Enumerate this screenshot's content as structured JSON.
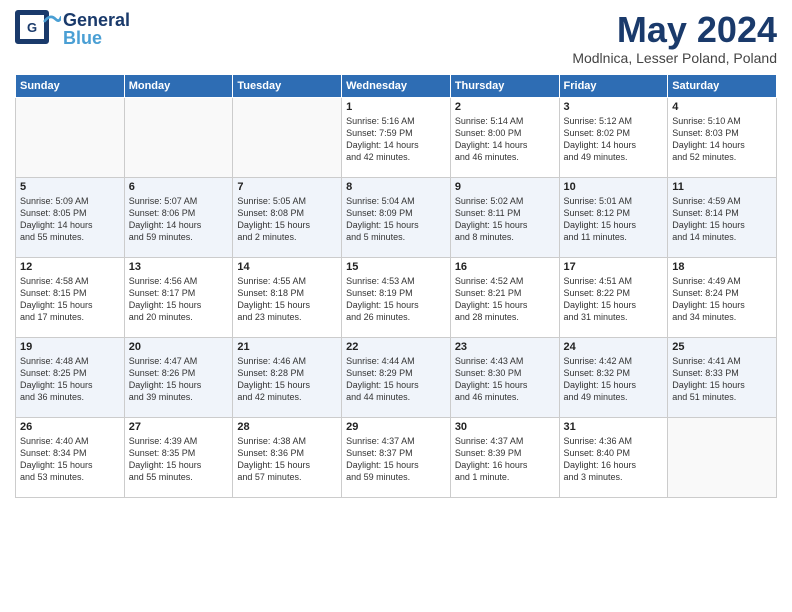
{
  "header": {
    "logo_general": "General",
    "logo_blue": "Blue",
    "title": "May 2024",
    "location": "Modlnica, Lesser Poland, Poland"
  },
  "columns": [
    "Sunday",
    "Monday",
    "Tuesday",
    "Wednesday",
    "Thursday",
    "Friday",
    "Saturday"
  ],
  "weeks": [
    [
      {
        "day": "",
        "info": ""
      },
      {
        "day": "",
        "info": ""
      },
      {
        "day": "",
        "info": ""
      },
      {
        "day": "1",
        "info": "Sunrise: 5:16 AM\nSunset: 7:59 PM\nDaylight: 14 hours\nand 42 minutes."
      },
      {
        "day": "2",
        "info": "Sunrise: 5:14 AM\nSunset: 8:00 PM\nDaylight: 14 hours\nand 46 minutes."
      },
      {
        "day": "3",
        "info": "Sunrise: 5:12 AM\nSunset: 8:02 PM\nDaylight: 14 hours\nand 49 minutes."
      },
      {
        "day": "4",
        "info": "Sunrise: 5:10 AM\nSunset: 8:03 PM\nDaylight: 14 hours\nand 52 minutes."
      }
    ],
    [
      {
        "day": "5",
        "info": "Sunrise: 5:09 AM\nSunset: 8:05 PM\nDaylight: 14 hours\nand 55 minutes."
      },
      {
        "day": "6",
        "info": "Sunrise: 5:07 AM\nSunset: 8:06 PM\nDaylight: 14 hours\nand 59 minutes."
      },
      {
        "day": "7",
        "info": "Sunrise: 5:05 AM\nSunset: 8:08 PM\nDaylight: 15 hours\nand 2 minutes."
      },
      {
        "day": "8",
        "info": "Sunrise: 5:04 AM\nSunset: 8:09 PM\nDaylight: 15 hours\nand 5 minutes."
      },
      {
        "day": "9",
        "info": "Sunrise: 5:02 AM\nSunset: 8:11 PM\nDaylight: 15 hours\nand 8 minutes."
      },
      {
        "day": "10",
        "info": "Sunrise: 5:01 AM\nSunset: 8:12 PM\nDaylight: 15 hours\nand 11 minutes."
      },
      {
        "day": "11",
        "info": "Sunrise: 4:59 AM\nSunset: 8:14 PM\nDaylight: 15 hours\nand 14 minutes."
      }
    ],
    [
      {
        "day": "12",
        "info": "Sunrise: 4:58 AM\nSunset: 8:15 PM\nDaylight: 15 hours\nand 17 minutes."
      },
      {
        "day": "13",
        "info": "Sunrise: 4:56 AM\nSunset: 8:17 PM\nDaylight: 15 hours\nand 20 minutes."
      },
      {
        "day": "14",
        "info": "Sunrise: 4:55 AM\nSunset: 8:18 PM\nDaylight: 15 hours\nand 23 minutes."
      },
      {
        "day": "15",
        "info": "Sunrise: 4:53 AM\nSunset: 8:19 PM\nDaylight: 15 hours\nand 26 minutes."
      },
      {
        "day": "16",
        "info": "Sunrise: 4:52 AM\nSunset: 8:21 PM\nDaylight: 15 hours\nand 28 minutes."
      },
      {
        "day": "17",
        "info": "Sunrise: 4:51 AM\nSunset: 8:22 PM\nDaylight: 15 hours\nand 31 minutes."
      },
      {
        "day": "18",
        "info": "Sunrise: 4:49 AM\nSunset: 8:24 PM\nDaylight: 15 hours\nand 34 minutes."
      }
    ],
    [
      {
        "day": "19",
        "info": "Sunrise: 4:48 AM\nSunset: 8:25 PM\nDaylight: 15 hours\nand 36 minutes."
      },
      {
        "day": "20",
        "info": "Sunrise: 4:47 AM\nSunset: 8:26 PM\nDaylight: 15 hours\nand 39 minutes."
      },
      {
        "day": "21",
        "info": "Sunrise: 4:46 AM\nSunset: 8:28 PM\nDaylight: 15 hours\nand 42 minutes."
      },
      {
        "day": "22",
        "info": "Sunrise: 4:44 AM\nSunset: 8:29 PM\nDaylight: 15 hours\nand 44 minutes."
      },
      {
        "day": "23",
        "info": "Sunrise: 4:43 AM\nSunset: 8:30 PM\nDaylight: 15 hours\nand 46 minutes."
      },
      {
        "day": "24",
        "info": "Sunrise: 4:42 AM\nSunset: 8:32 PM\nDaylight: 15 hours\nand 49 minutes."
      },
      {
        "day": "25",
        "info": "Sunrise: 4:41 AM\nSunset: 8:33 PM\nDaylight: 15 hours\nand 51 minutes."
      }
    ],
    [
      {
        "day": "26",
        "info": "Sunrise: 4:40 AM\nSunset: 8:34 PM\nDaylight: 15 hours\nand 53 minutes."
      },
      {
        "day": "27",
        "info": "Sunrise: 4:39 AM\nSunset: 8:35 PM\nDaylight: 15 hours\nand 55 minutes."
      },
      {
        "day": "28",
        "info": "Sunrise: 4:38 AM\nSunset: 8:36 PM\nDaylight: 15 hours\nand 57 minutes."
      },
      {
        "day": "29",
        "info": "Sunrise: 4:37 AM\nSunset: 8:37 PM\nDaylight: 15 hours\nand 59 minutes."
      },
      {
        "day": "30",
        "info": "Sunrise: 4:37 AM\nSunset: 8:39 PM\nDaylight: 16 hours\nand 1 minute."
      },
      {
        "day": "31",
        "info": "Sunrise: 4:36 AM\nSunset: 8:40 PM\nDaylight: 16 hours\nand 3 minutes."
      },
      {
        "day": "",
        "info": ""
      }
    ]
  ]
}
